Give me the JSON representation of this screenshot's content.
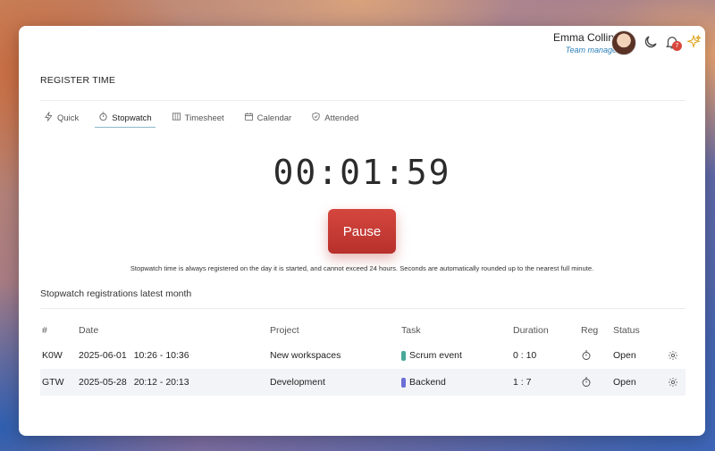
{
  "user": {
    "name": "Emma Collins",
    "role": "Team manager",
    "notification_count": "7"
  },
  "page_title": "REGISTER TIME",
  "tabs": [
    {
      "label": "Quick",
      "icon": "lightning-icon"
    },
    {
      "label": "Stopwatch",
      "icon": "stopwatch-icon",
      "active": true
    },
    {
      "label": "Timesheet",
      "icon": "timesheet-icon"
    },
    {
      "label": "Calendar",
      "icon": "calendar-icon"
    },
    {
      "label": "Attended",
      "icon": "shield-check-icon"
    }
  ],
  "stopwatch": {
    "time": "00:01:59",
    "pause_label": "Pause",
    "note": "Stopwatch time is always registered on the day it is started, and cannot exceed 24 hours. Seconds are automatically rounded up to the nearest full minute."
  },
  "registrations": {
    "title": "Stopwatch registrations latest month",
    "columns": [
      "#",
      "Date",
      "Project",
      "Task",
      "Duration",
      "Reg",
      "Status"
    ],
    "rows": [
      {
        "id": "K0W",
        "date": "2025-06-01",
        "time": "10:26 - 10:36",
        "project": "New workspaces",
        "task": "Scrum event",
        "task_color": "#4aa89a",
        "duration": "0 : 10",
        "status": "Open"
      },
      {
        "id": "GTW",
        "date": "2025-05-28",
        "time": "20:12 - 20:13",
        "project": "Development",
        "task": "Backend",
        "task_color": "#6b6fd6",
        "duration": "1 : 7",
        "status": "Open"
      }
    ]
  },
  "colors": {
    "accent_red": "#c93a34",
    "link_blue": "#2a7fb8"
  }
}
